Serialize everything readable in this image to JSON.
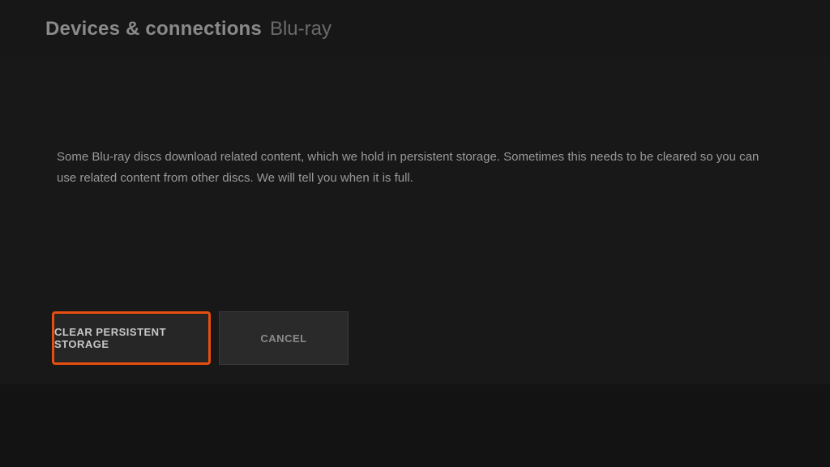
{
  "header": {
    "section": "Devices & connections",
    "page": "Blu-ray"
  },
  "description": "Some Blu-ray discs download related content, which we hold in persistent storage.  Sometimes this needs to be cleared so you can use related content from other discs. We will tell you when it is full.",
  "buttons": {
    "primary": "CLEAR PERSISTENT STORAGE",
    "secondary": "CANCEL"
  },
  "colors": {
    "accent": "#e84e10"
  }
}
